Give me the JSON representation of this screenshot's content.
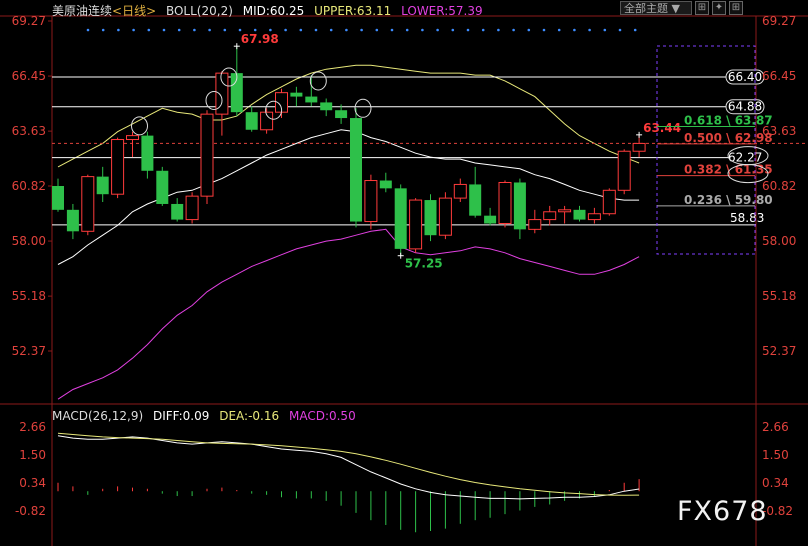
{
  "header": {
    "symbol": "美原油连续",
    "period": "<日线>",
    "boll": "BOLL(20,2)",
    "mid": "MID:60.25",
    "upper": "UPPER:63.11",
    "lower": "LOWER:57.39"
  },
  "toolbar": {
    "select_label": "全部主题",
    "btn1": "⊞",
    "btn2": "✦",
    "btn3": "⊞"
  },
  "macd_header": {
    "title": "MACD(26,12,9)",
    "diff": "DIFF:0.09",
    "dea": "DEA:-0.16",
    "macd": "MACD:0.50"
  },
  "watermark": "FX678",
  "colors": {
    "up": "#ff3b3b",
    "down": "#2ec04a",
    "boll_upper": "#e8e87a",
    "boll_mid": "#ffffff",
    "boll_lower": "#e040e0",
    "axis": "#e0423c",
    "macd_diff": "#ffffff",
    "macd_dea": "#e8e87a"
  },
  "chart_data": [
    {
      "type": "candlestick",
      "title": "美原油连续 <日线>",
      "y_ticks": [
        69.27,
        66.45,
        63.63,
        60.82,
        58.0,
        55.18,
        52.37
      ],
      "ylim": [
        49.55,
        69.27
      ],
      "candles": [
        {
          "o": 60.82,
          "h": 61.2,
          "l": 59.5,
          "c": 59.6
        },
        {
          "o": 59.6,
          "h": 59.9,
          "l": 58.1,
          "c": 58.5
        },
        {
          "o": 58.5,
          "h": 61.4,
          "l": 58.3,
          "c": 61.3
        },
        {
          "o": 61.3,
          "h": 61.8,
          "l": 60.0,
          "c": 60.4
        },
        {
          "o": 60.4,
          "h": 63.3,
          "l": 60.2,
          "c": 63.2
        },
        {
          "o": 63.2,
          "h": 63.6,
          "l": 62.3,
          "c": 63.4
        },
        {
          "o": 63.4,
          "h": 63.6,
          "l": 61.2,
          "c": 61.6
        },
        {
          "o": 61.6,
          "h": 61.8,
          "l": 59.8,
          "c": 59.9
        },
        {
          "o": 59.9,
          "h": 60.2,
          "l": 59.0,
          "c": 59.1
        },
        {
          "o": 59.1,
          "h": 60.5,
          "l": 58.9,
          "c": 60.3
        },
        {
          "o": 60.3,
          "h": 64.7,
          "l": 59.9,
          "c": 64.5
        },
        {
          "o": 64.5,
          "h": 66.7,
          "l": 63.4,
          "c": 66.6
        },
        {
          "o": 66.6,
          "h": 67.98,
          "l": 64.4,
          "c": 64.6
        },
        {
          "o": 64.6,
          "h": 64.9,
          "l": 63.6,
          "c": 63.7
        },
        {
          "o": 63.7,
          "h": 64.8,
          "l": 63.5,
          "c": 64.6
        },
        {
          "o": 64.6,
          "h": 65.8,
          "l": 64.3,
          "c": 65.6
        },
        {
          "o": 65.6,
          "h": 65.9,
          "l": 64.9,
          "c": 65.4
        },
        {
          "o": 65.4,
          "h": 66.5,
          "l": 64.9,
          "c": 65.1
        },
        {
          "o": 65.1,
          "h": 65.3,
          "l": 64.4,
          "c": 64.7
        },
        {
          "o": 64.7,
          "h": 65.0,
          "l": 64.0,
          "c": 64.3
        },
        {
          "o": 64.3,
          "h": 64.8,
          "l": 58.7,
          "c": 59.0
        },
        {
          "o": 59.0,
          "h": 61.4,
          "l": 58.6,
          "c": 61.1
        },
        {
          "o": 61.1,
          "h": 61.5,
          "l": 60.5,
          "c": 60.7
        },
        {
          "o": 60.7,
          "h": 60.9,
          "l": 57.25,
          "c": 57.6
        },
        {
          "o": 57.6,
          "h": 60.2,
          "l": 57.4,
          "c": 60.1
        },
        {
          "o": 60.1,
          "h": 60.4,
          "l": 58.0,
          "c": 58.3
        },
        {
          "o": 58.3,
          "h": 60.5,
          "l": 58.1,
          "c": 60.2
        },
        {
          "o": 60.2,
          "h": 61.2,
          "l": 60.0,
          "c": 60.9
        },
        {
          "o": 60.9,
          "h": 61.8,
          "l": 59.2,
          "c": 59.3
        },
        {
          "o": 59.3,
          "h": 59.7,
          "l": 58.8,
          "c": 58.9
        },
        {
          "o": 58.9,
          "h": 61.1,
          "l": 58.7,
          "c": 61.0
        },
        {
          "o": 61.0,
          "h": 61.2,
          "l": 58.1,
          "c": 58.6
        },
        {
          "o": 58.6,
          "h": 59.6,
          "l": 58.4,
          "c": 59.1
        },
        {
          "o": 59.1,
          "h": 59.8,
          "l": 58.8,
          "c": 59.5
        },
        {
          "o": 59.5,
          "h": 59.8,
          "l": 58.9,
          "c": 59.6
        },
        {
          "o": 59.6,
          "h": 59.8,
          "l": 59.0,
          "c": 59.1
        },
        {
          "o": 59.1,
          "h": 59.7,
          "l": 58.9,
          "c": 59.4
        },
        {
          "o": 59.4,
          "h": 60.7,
          "l": 59.3,
          "c": 60.6
        },
        {
          "o": 60.6,
          "h": 62.7,
          "l": 60.4,
          "c": 62.6
        },
        {
          "o": 62.6,
          "h": 63.44,
          "l": 62.3,
          "c": 63.0
        }
      ],
      "boll_upper": [
        61.8,
        62.2,
        62.6,
        63.0,
        63.6,
        64.0,
        64.4,
        64.8,
        64.6,
        64.5,
        64.2,
        64.2,
        64.4,
        65.0,
        65.5,
        65.9,
        66.3,
        66.6,
        66.8,
        66.9,
        67.0,
        67.0,
        66.9,
        66.8,
        66.7,
        66.6,
        66.6,
        66.6,
        66.5,
        66.5,
        66.2,
        65.8,
        65.4,
        64.7,
        64.0,
        63.4,
        63.0,
        62.6,
        62.3,
        62.0
      ],
      "boll_mid": [
        56.8,
        57.2,
        57.8,
        58.3,
        58.8,
        59.5,
        59.9,
        60.2,
        60.5,
        60.6,
        60.9,
        61.2,
        61.6,
        62.0,
        62.4,
        62.7,
        63.0,
        63.3,
        63.5,
        63.7,
        63.6,
        63.3,
        63.1,
        62.8,
        62.5,
        62.3,
        62.2,
        62.2,
        62.0,
        61.9,
        61.8,
        61.7,
        61.4,
        61.2,
        60.9,
        60.6,
        60.4,
        60.2,
        60.1,
        60.1
      ],
      "boll_lower": [
        49.9,
        50.4,
        50.7,
        51.0,
        51.4,
        52.0,
        52.7,
        53.5,
        54.2,
        54.7,
        55.4,
        55.9,
        56.3,
        56.7,
        57.0,
        57.3,
        57.6,
        57.8,
        58.0,
        58.1,
        58.3,
        58.5,
        58.6,
        57.7,
        57.4,
        57.3,
        57.4,
        57.5,
        57.7,
        57.6,
        57.4,
        57.1,
        56.9,
        56.7,
        56.5,
        56.3,
        56.3,
        56.5,
        56.8,
        57.2
      ],
      "annotations": [
        {
          "text": "67.98",
          "x": 12,
          "y": 67.98
        },
        {
          "text": "57.25",
          "x": 23,
          "y": 57.25
        },
        {
          "text": "63.44",
          "x": 39,
          "y": 63.44
        }
      ],
      "horizontal_lines": [
        {
          "label": "66.40",
          "value": 66.4
        },
        {
          "label": "64.88",
          "value": 64.88
        },
        {
          "label": "62.27",
          "value": 62.27
        },
        {
          "label": "58.83",
          "value": 58.83
        },
        {
          "label": "63.44 dashed",
          "value": 63.0
        }
      ],
      "fibonacci": [
        {
          "label": "0.618 \\ 63.87",
          "ratio": 0.618,
          "value": 63.87,
          "color": "#2ec04a"
        },
        {
          "label": "0.500 \\ 62.98",
          "ratio": 0.5,
          "value": 62.98,
          "color": "#e0423c"
        },
        {
          "label": "0.382 \\ 61.35",
          "ratio": 0.382,
          "value": 61.35,
          "color": "#e0423c"
        },
        {
          "label": "0.236 \\ 59.80",
          "ratio": 0.236,
          "value": 59.8,
          "color": "#aaaaaa"
        }
      ]
    },
    {
      "type": "macd",
      "title": "MACD(26,12,9)",
      "y_ticks": [
        2.66,
        1.5,
        0.34,
        -0.82
      ],
      "ylim": [
        -2.0,
        2.66
      ],
      "diff": [
        2.3,
        2.2,
        2.15,
        2.15,
        2.2,
        2.25,
        2.2,
        2.1,
        2.0,
        1.95,
        2.0,
        2.05,
        2.0,
        1.95,
        1.85,
        1.75,
        1.7,
        1.65,
        1.55,
        1.4,
        1.1,
        0.8,
        0.55,
        0.3,
        0.1,
        -0.05,
        -0.15,
        -0.2,
        -0.25,
        -0.3,
        -0.3,
        -0.32,
        -0.3,
        -0.28,
        -0.25,
        -0.25,
        -0.22,
        -0.15,
        0.0,
        0.09
      ],
      "dea": [
        2.4,
        2.35,
        2.3,
        2.25,
        2.22,
        2.2,
        2.18,
        2.15,
        2.1,
        2.05,
        2.0,
        1.98,
        1.97,
        1.95,
        1.92,
        1.88,
        1.83,
        1.78,
        1.72,
        1.65,
        1.55,
        1.42,
        1.28,
        1.12,
        0.95,
        0.78,
        0.62,
        0.48,
        0.36,
        0.26,
        0.18,
        0.1,
        0.04,
        -0.02,
        -0.07,
        -0.1,
        -0.14,
        -0.16,
        -0.17,
        -0.16
      ],
      "macd_hist": [
        0.35,
        0.2,
        -0.15,
        0.1,
        0.2,
        0.15,
        0.1,
        -0.1,
        -0.2,
        -0.2,
        0.1,
        0.15,
        0.05,
        -0.1,
        -0.15,
        -0.25,
        -0.3,
        -0.3,
        -0.4,
        -0.6,
        -0.9,
        -1.2,
        -1.4,
        -1.6,
        -1.7,
        -1.65,
        -1.55,
        -1.35,
        -1.2,
        -1.1,
        -0.95,
        -0.8,
        -0.65,
        -0.55,
        -0.4,
        -0.3,
        -0.2,
        0.05,
        0.35,
        0.5
      ]
    }
  ]
}
